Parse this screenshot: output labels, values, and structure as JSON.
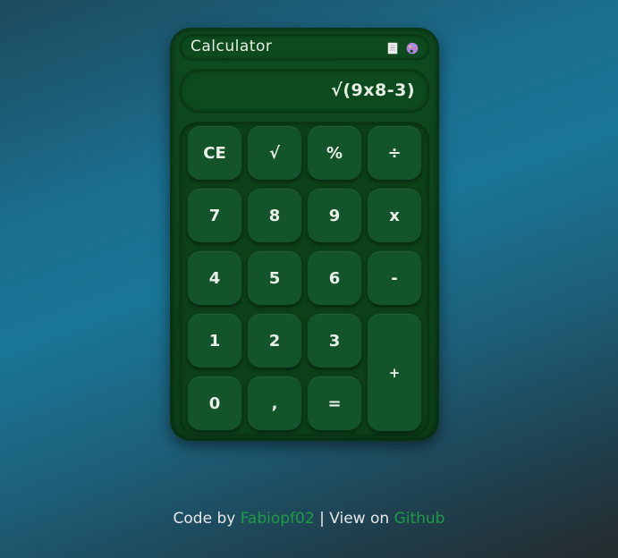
{
  "app": {
    "title": "Calculator",
    "icons": [
      "history-icon",
      "theme-palette-icon"
    ]
  },
  "display": {
    "expression": "√(9x8-3)"
  },
  "keys": {
    "ce": "CE",
    "sqrt": "√",
    "percent": "%",
    "divide": "÷",
    "seven": "7",
    "eight": "8",
    "nine": "9",
    "multiply": "x",
    "four": "4",
    "five": "5",
    "six": "6",
    "minus": "-",
    "one": "1",
    "two": "2",
    "three": "3",
    "plus": "+",
    "zero": "0",
    "comma": ",",
    "equals": "="
  },
  "footer": {
    "prefix": "Code by ",
    "author": "Fabiopf02",
    "separator": " | View on ",
    "link": "Github"
  },
  "colors": {
    "calculator_body": "#0f4a1f",
    "key_background": "#14542a",
    "link_green": "#1f9a45",
    "text": "#e6efe6"
  }
}
